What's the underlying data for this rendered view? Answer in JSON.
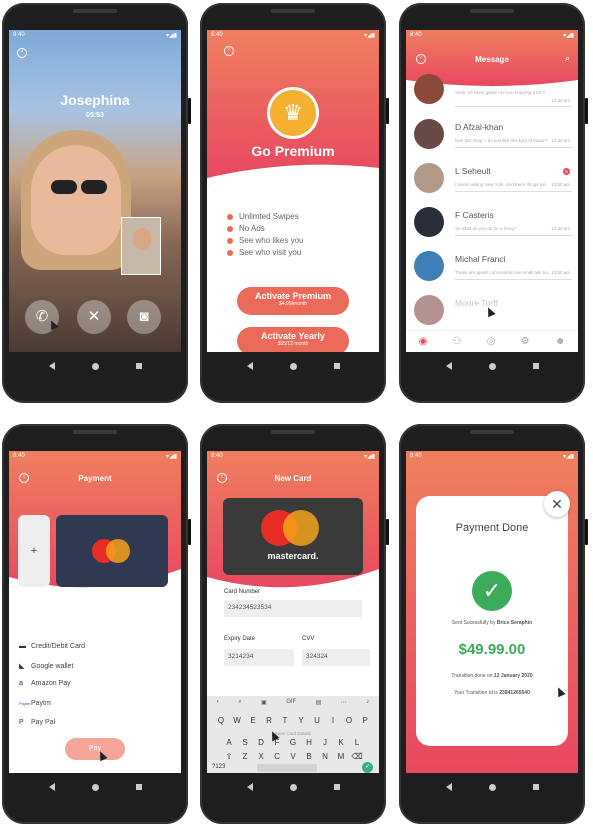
{
  "status": {
    "time": "8:40"
  },
  "call": {
    "name": "Josephina",
    "duration": "05:53"
  },
  "premium": {
    "title": "Go Premium",
    "features": [
      "Unlimted Swipes",
      "No Ads",
      "See who likes you",
      "See who visit you"
    ],
    "btn_monthly": {
      "label": "Activate Premium",
      "price": "$4.99/month"
    },
    "btn_yearly": {
      "label": "Activate Yearly",
      "price": "$55/12 month"
    }
  },
  "messages": {
    "title": "Message",
    "items": [
      {
        "name": "",
        "text": "Yeah, it's been great! Are you enjoying it too?",
        "time": "12:30 am"
      },
      {
        "name": "D Afzal-khan",
        "text": "love this song ~ do you like this kind of music?",
        "time": "12:30 am"
      },
      {
        "name": "L Seheult",
        "text": "I loved visiting New York. And there things too",
        "time": "12:30 am",
        "badge": "6"
      },
      {
        "name": "F Casteris",
        "text": "So what do you do for a living?",
        "time": "12:30 am"
      },
      {
        "name": "Michal Franci",
        "text": "These are great! I absolutely love small talk too",
        "time": "12:30 am"
      },
      {
        "name": "Moore Torff",
        "text": "",
        "time": ""
      }
    ]
  },
  "payment": {
    "title": "Payment",
    "add_label": "+",
    "methods": [
      {
        "icon": "card-icon",
        "label": "Credit/Debit Card"
      },
      {
        "icon": "wallet-icon",
        "label": "Google wallet"
      },
      {
        "icon": "amazon-icon",
        "label": "Amazon Pay"
      },
      {
        "icon": "paytm-icon",
        "label": "Paytm"
      },
      {
        "icon": "paypal-icon",
        "label": "Pay Pal"
      }
    ],
    "pay_label": "Pay"
  },
  "newcard": {
    "title": "New Card",
    "brand": "mastercard.",
    "card_number_label": "Card Number",
    "card_number": "234234523534",
    "expiry_label": "Expiry Date",
    "expiry": "3214234",
    "cvv_label": "CVV",
    "cvv": "324324",
    "save_hint": "Save Card Details",
    "keyboard": {
      "row1": [
        "Q",
        "W",
        "E",
        "R",
        "T",
        "Y",
        "U",
        "I",
        "O",
        "P"
      ],
      "row2": [
        "A",
        "S",
        "D",
        "F",
        "G",
        "H",
        "J",
        "K",
        "L"
      ],
      "row3": [
        "Z",
        "X",
        "C",
        "V",
        "B",
        "N",
        "M"
      ],
      "num_label": "?123"
    }
  },
  "done": {
    "title": "Payment Done",
    "sent_prefix": "Sent Sucessfully by",
    "sent_name": "Brice Seraphin",
    "amount": "$49.99.00",
    "date_prefix": "Transition done on",
    "date": "12 January 2020",
    "id_prefix": "Your Transition Id is",
    "id": "23841265540"
  },
  "colors": {
    "accent": "#ec6a5a",
    "success": "#3cab5a",
    "card_dark": "#2f3a52"
  }
}
